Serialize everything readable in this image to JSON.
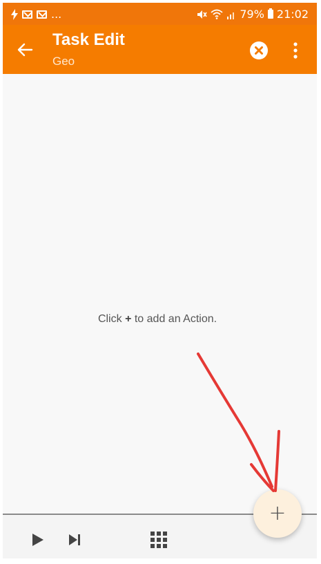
{
  "status_bar": {
    "left_icons": [
      "flash-icon",
      "gmail-icon",
      "gmail-icon"
    ],
    "overflow": "...",
    "right_icons": [
      "mute-icon",
      "wifi-icon",
      "signal-icon",
      "battery-icon"
    ],
    "battery": "79%",
    "time": "21:02",
    "background": "#f0760a"
  },
  "app_bar": {
    "title": "Task Edit",
    "subtitle": "Geo",
    "back_icon": "arrow-back-icon",
    "cancel_icon": "close-circle-icon",
    "menu_icon": "more-vert-icon",
    "background": "#f57c00"
  },
  "content": {
    "hint_prefix": "Click",
    "hint_symbol": "+",
    "hint_suffix": "to add an Action."
  },
  "bottom_bar": {
    "play_icon": "play-icon",
    "step_icon": "skip-next-icon",
    "grid_icon": "grid-icon"
  },
  "fab": {
    "label": "+",
    "background": "#fdf0dd"
  },
  "annotation": {
    "color": "#e53935",
    "icon": "arrow-annotation-icon"
  }
}
